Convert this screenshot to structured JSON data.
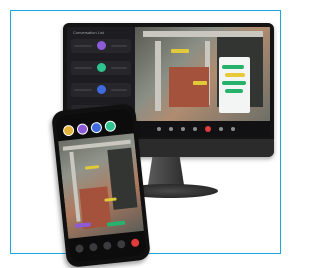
{
  "monitor": {
    "sidebar_title": "Conversation List",
    "sidebar_rows": [
      {
        "avatar_color": "#8e5bd8"
      },
      {
        "avatar_color": "#2fc48f"
      },
      {
        "avatar_color": "#3f6be0"
      },
      {
        "avatar_color": "#e05aa8"
      }
    ],
    "chat_bubble_colors": [
      "#27b26b",
      "#e8c93a",
      "#27b26b",
      "#27b26b"
    ],
    "toolbar_end_color": "#e23b3b"
  },
  "phone": {
    "avatar_colors": [
      "#e4b43a",
      "#8e5bd8",
      "#3f6be0",
      "#2fc48f"
    ],
    "control_count": 5
  },
  "colors": {
    "frame_border": "#1ea7e1",
    "device_body": "#141414"
  }
}
